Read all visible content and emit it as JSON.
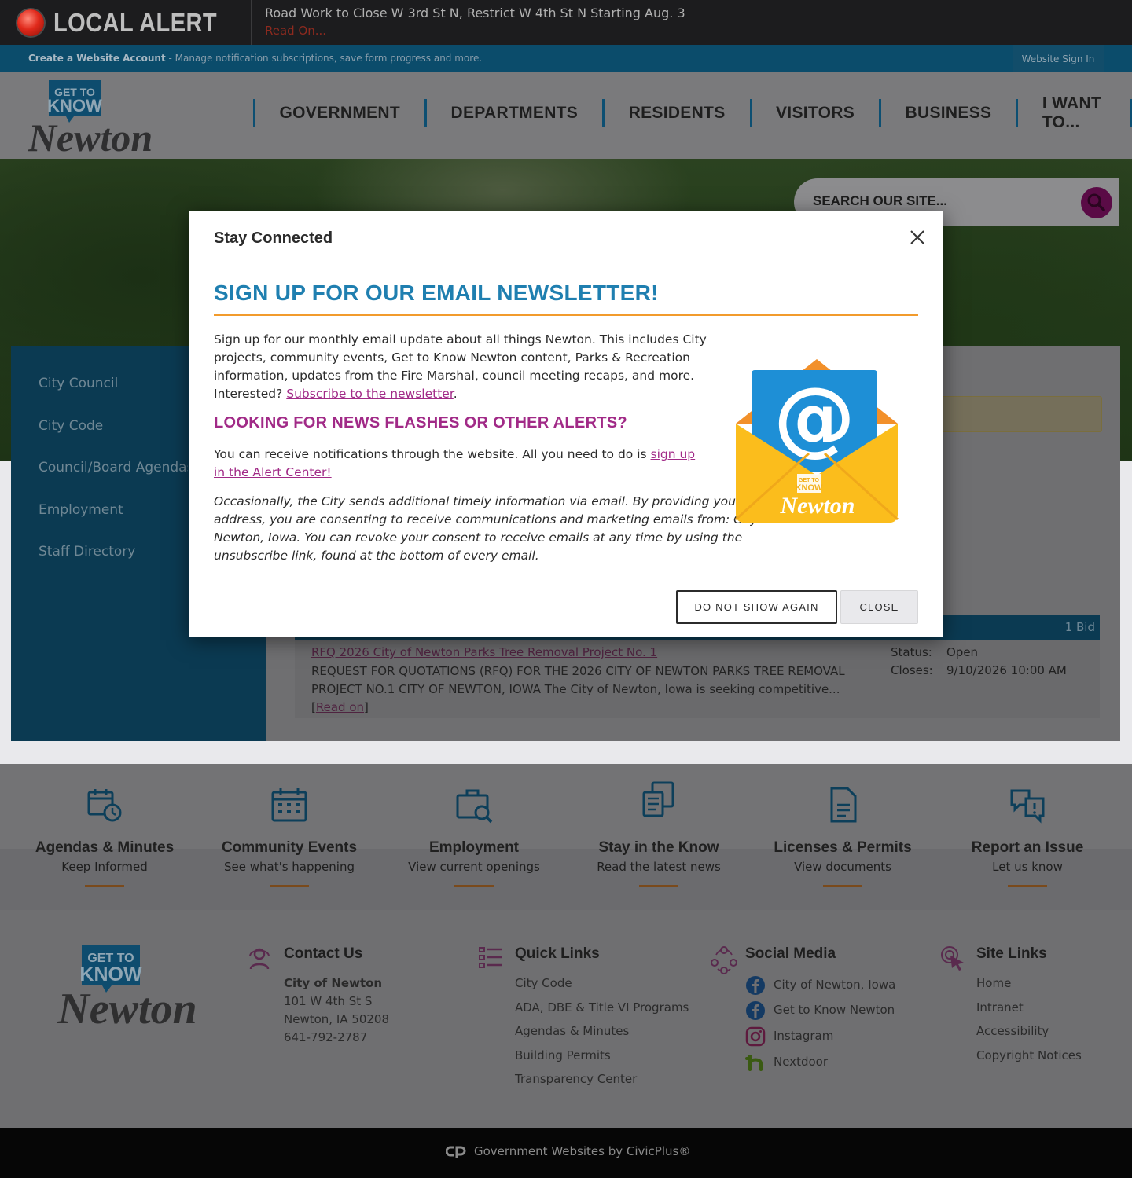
{
  "alert": {
    "label": "LOCAL ALERT",
    "message": "Road Work to Close W 3rd St N, Restrict W 4th St N Starting Aug. 3",
    "read_on": "Read On..."
  },
  "account_bar": {
    "create_label": "Create a Website Account",
    "create_desc": " - Manage notification subscriptions, save form progress and more.",
    "sign_in": "Website Sign In"
  },
  "logo": {
    "top": "GET TO",
    "mid": "KNOW",
    "name": "Newton"
  },
  "nav": [
    "GOVERNMENT",
    "DEPARTMENTS",
    "RESIDENTS",
    "VISITORS",
    "BUSINESS",
    "I WANT TO..."
  ],
  "search": {
    "placeholder": "SEARCH OUR SITE..."
  },
  "sidebar": {
    "items": [
      "City Council",
      "City Code",
      "Council/Board Agendas",
      "Employment",
      "Staff Directory"
    ]
  },
  "bids": {
    "count": "1 Bid",
    "item": {
      "title": "RFQ 2026 City of Newton Parks Tree Removal Project No. 1",
      "description": "REQUEST FOR QUOTATIONS (RFQ) FOR THE 2026 CITY OF NEWTON PARKS TREE REMOVAL PROJECT NO.1 CITY OF NEWTON, IOWA The City of Newton, Iowa is seeking competitive...",
      "read_on": "Read on",
      "status_label": "Status:",
      "status_value": "Open",
      "closes_label": "Closes:",
      "closes_value": "9/10/2026 10:00 AM"
    }
  },
  "tiles": [
    {
      "title": "Agendas & Minutes",
      "sub": "Keep Informed",
      "icon": "calendar-clock-icon"
    },
    {
      "title": "Community Events",
      "sub": "See what's happening",
      "icon": "calendar-grid-icon"
    },
    {
      "title": "Employment",
      "sub": "View current openings",
      "icon": "briefcase-search-icon"
    },
    {
      "title": "Stay in the Know",
      "sub": "Read the latest news",
      "icon": "news-icon"
    },
    {
      "title": "Licenses & Permits",
      "sub": "View documents",
      "icon": "document-icon"
    },
    {
      "title": "Report an Issue",
      "sub": "Let us know",
      "icon": "chat-alert-icon"
    }
  ],
  "footer": {
    "contact": {
      "heading": "Contact Us",
      "name": "City of Newton",
      "address1": "101 W 4th St S",
      "address2": "Newton, IA 50208",
      "phone": "641-792-2787"
    },
    "quick_links": {
      "heading": "Quick Links",
      "items": [
        "City Code",
        "ADA, DBE & Title VI Programs",
        "Agendas & Minutes",
        "Building Permits",
        "Transparency Center"
      ]
    },
    "social": {
      "heading": "Social Media",
      "items": [
        "City of Newton, Iowa",
        "Get to Know Newton",
        "Instagram",
        "Nextdoor"
      ]
    },
    "site_links": {
      "heading": "Site Links",
      "items": [
        "Home",
        "Intranet",
        "Accessibility",
        "Copyright Notices"
      ]
    }
  },
  "copyright": "Government Websites by CivicPlus®",
  "modal": {
    "heading": "Stay Connected",
    "title": "SIGN UP FOR OUR EMAIL NEWSLETTER!",
    "p1_text": "Sign up for our monthly email update about all things Newton. This includes City projects, community events, Get to Know Newton content, Parks & Recreation information, updates from the Fire Marshal, council meeting recaps, and more. Interested? ",
    "p1_link": "Subscribe to the newsletter",
    "subtitle": "LOOKING FOR NEWS FLASHES OR OTHER ALERTS?",
    "p2_text": "You can receive notifications through the website. All you need to do is ",
    "p2_link": "sign up in the Alert Center!",
    "p3": "Occasionally, the City sends additional timely information via email. By providing your email address, you are consenting to receive communications and marketing emails from: City of Newton, Iowa. You can revoke your consent to receive emails at any time by using the unsubscribe link, found at the bottom of every email.",
    "envelope_top": "GET TO",
    "envelope_mid": "KNOW",
    "envelope_name": "Newton",
    "btn_dont_show": "DO NOT SHOW AGAIN",
    "btn_close": "CLOSE"
  },
  "colors": {
    "brand_blue": "#1f7fb0",
    "accent_purple": "#a12a87",
    "accent_orange": "#f29b2c",
    "nav_blue": "#0b4c6b"
  }
}
